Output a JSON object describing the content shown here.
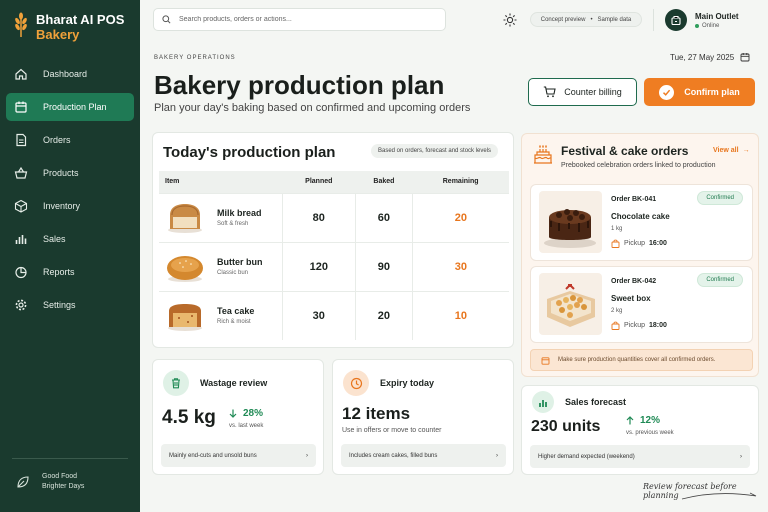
{
  "brand": {
    "name": "Bharat AI POS",
    "sub": "Bakery"
  },
  "nav": [
    {
      "label": "Dashboard",
      "icon": "home-icon"
    },
    {
      "label": "Production Plan",
      "icon": "calendar-icon",
      "active": true
    },
    {
      "label": "Orders",
      "icon": "document-icon"
    },
    {
      "label": "Products",
      "icon": "basket-icon"
    },
    {
      "label": "Inventory",
      "icon": "box-icon"
    },
    {
      "label": "Sales",
      "icon": "bar-chart-icon"
    },
    {
      "label": "Reports",
      "icon": "pie-chart-icon"
    },
    {
      "label": "Settings",
      "icon": "gear-icon"
    }
  ],
  "sidebar_footer": {
    "line1": "Good Food",
    "line2": "Brighter Days"
  },
  "search": {
    "placeholder": "Search products, orders or actions..."
  },
  "pill": {
    "left": "Concept preview",
    "right": "Sample data"
  },
  "outlet": {
    "name": "Main Outlet",
    "status": "Online"
  },
  "header": {
    "eyebrow": "BAKERY OPERATIONS",
    "date": "Tue, 27 May 2025",
    "title": "Bakery production plan",
    "subtitle": "Plan your day's baking based on confirmed and upcoming orders",
    "counter_btn": "Counter billing",
    "confirm_btn": "Confirm plan"
  },
  "plan": {
    "title": "Today's production plan",
    "tag": "Based on orders, forecast and stock levels",
    "columns": [
      "Item",
      "Planned",
      "Baked",
      "Remaining"
    ],
    "rows": [
      {
        "name": "Milk bread",
        "desc": "Soft & fresh",
        "planned": "80",
        "baked": "60",
        "remaining": "20"
      },
      {
        "name": "Butter bun",
        "desc": "Classic bun",
        "planned": "120",
        "baked": "90",
        "remaining": "30"
      },
      {
        "name": "Tea cake",
        "desc": "Rich & moist",
        "planned": "30",
        "baked": "20",
        "remaining": "10"
      }
    ]
  },
  "wastage": {
    "title": "Wastage review",
    "value": "4.5 kg",
    "delta": "28%",
    "delta_sub": "vs. last week",
    "note": "Mainly end-cuts and unsold buns"
  },
  "expiry": {
    "title": "Expiry today",
    "value": "12 items",
    "sub": "Use in offers or move to counter",
    "note": "Includes cream cakes, filled buns"
  },
  "festival": {
    "title": "Festival & cake orders",
    "view_all": "View all",
    "subtitle": "Prebooked celebration orders linked to production",
    "orders": [
      {
        "id": "Order BK-041",
        "name": "Chocolate cake",
        "qty": "1 kg",
        "pickup_label": "Pickup",
        "time": "16:00",
        "status": "Confirmed"
      },
      {
        "id": "Order BK-042",
        "name": "Sweet box",
        "qty": "2 kg",
        "pickup_label": "Pickup",
        "time": "18:00",
        "status": "Confirmed"
      }
    ],
    "warning": "Make sure production quantities cover all confirmed orders."
  },
  "forecast": {
    "title": "Sales forecast",
    "value": "230 units",
    "delta": "12%",
    "delta_sub": "vs. previous week",
    "note": "Higher demand expected (weekend)"
  },
  "footer_note": "Review forecast before planning",
  "colors": {
    "sidebar": "#1a3a2e",
    "accent": "#ef7d22",
    "active_nav": "#1f7a55",
    "positive": "#1f8a55"
  }
}
